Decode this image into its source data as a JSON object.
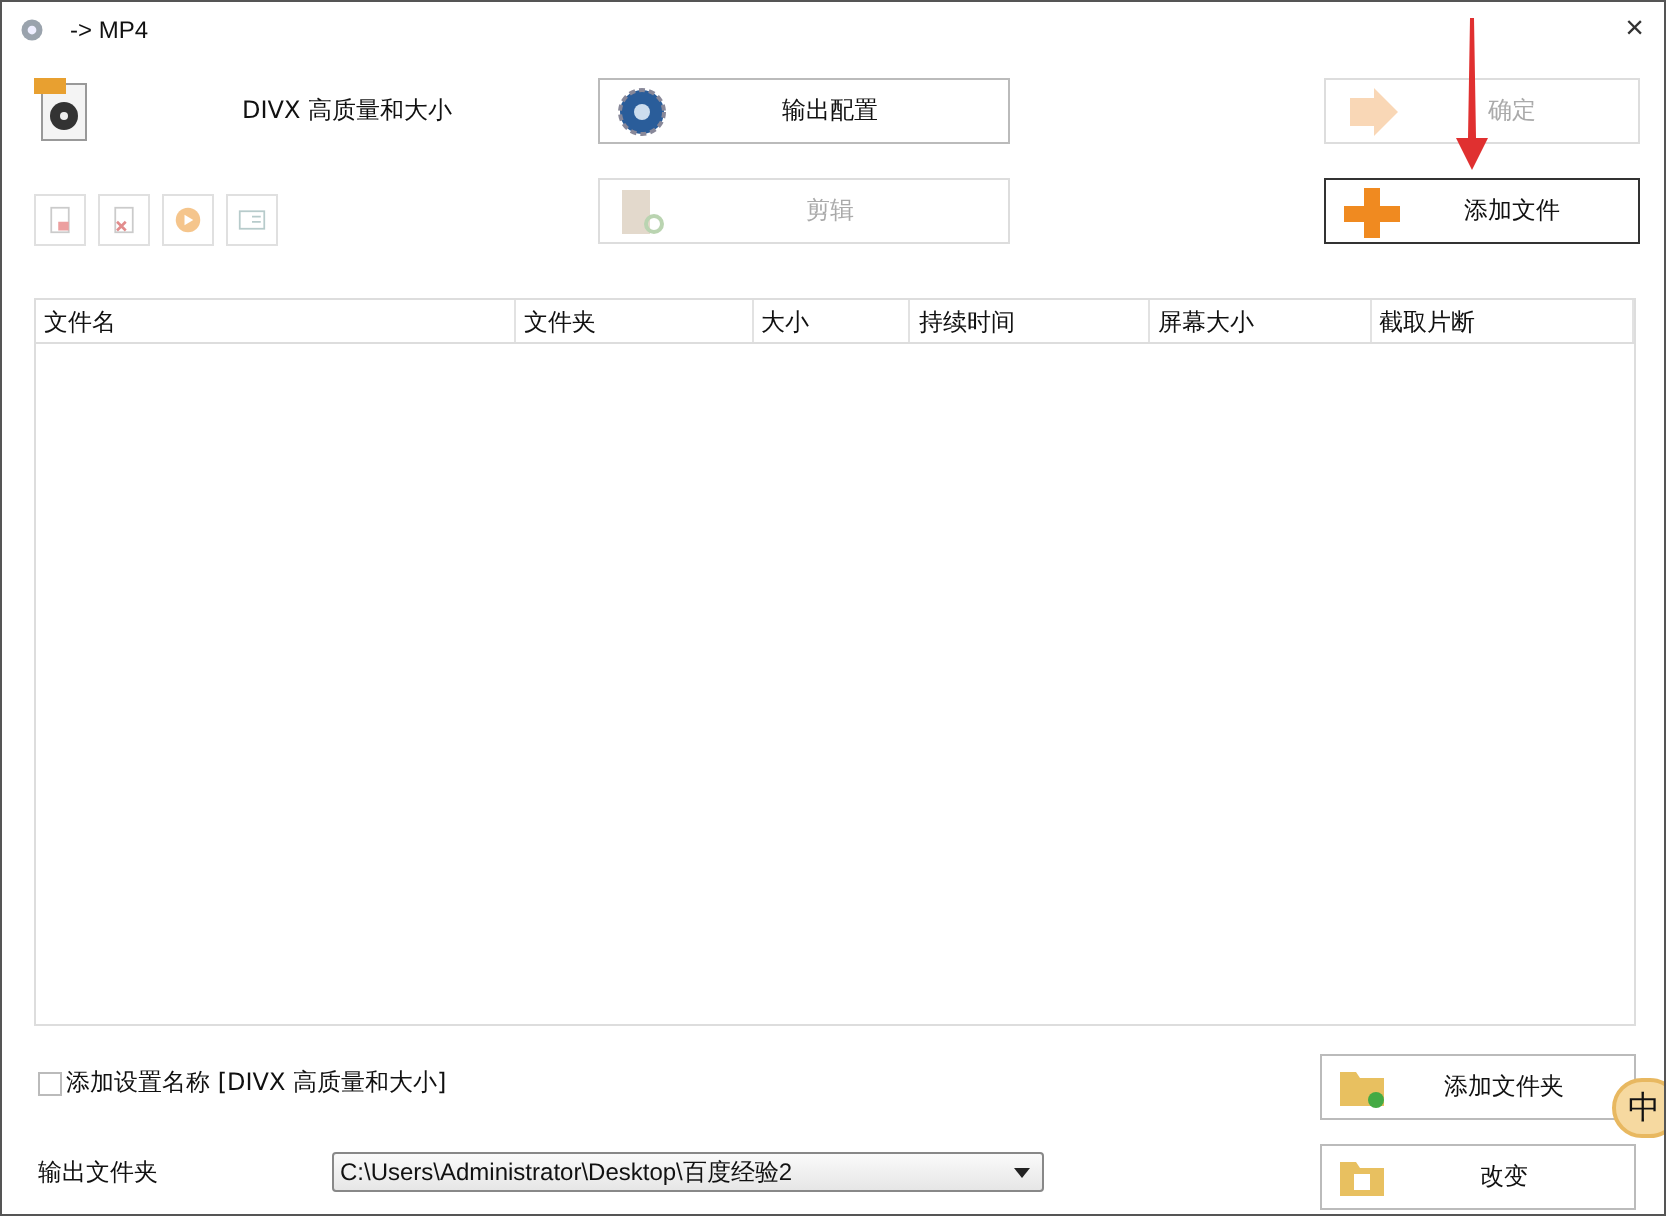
{
  "window": {
    "title": "-> MP4",
    "close": "×"
  },
  "preset": {
    "name": "DIVX 高质量和大小"
  },
  "toolbar": [
    {
      "kind": "remove",
      "disabled": true
    },
    {
      "kind": "clear",
      "disabled": true
    },
    {
      "kind": "play",
      "disabled": true
    },
    {
      "kind": "info",
      "disabled": true
    }
  ],
  "buttons": [
    {
      "kind": "config",
      "label": "输出配置",
      "disabled": false
    },
    {
      "kind": "ok",
      "label": "确定",
      "disabled": true
    },
    {
      "kind": "cut",
      "label": "剪辑",
      "disabled": true
    },
    {
      "kind": "add",
      "label": "添加文件",
      "disabled": false
    }
  ],
  "table": {
    "columns": [
      "文件名",
      "文件夹",
      "大小",
      "持续时间",
      "屏幕大小",
      "截取片断"
    ]
  },
  "add_setting_name": {
    "label": "添加设置名称 [DIVX 高质量和大小]",
    "checked": false
  },
  "bottom_buttons": [
    {
      "kind": "folder",
      "label": "添加文件夹"
    },
    {
      "kind": "change",
      "label": "改变"
    }
  ],
  "output_folder": {
    "label": "输出文件夹",
    "value": "C:\\Users\\Administrator\\Desktop\\百度经验2"
  },
  "ime": {
    "label": "中"
  }
}
